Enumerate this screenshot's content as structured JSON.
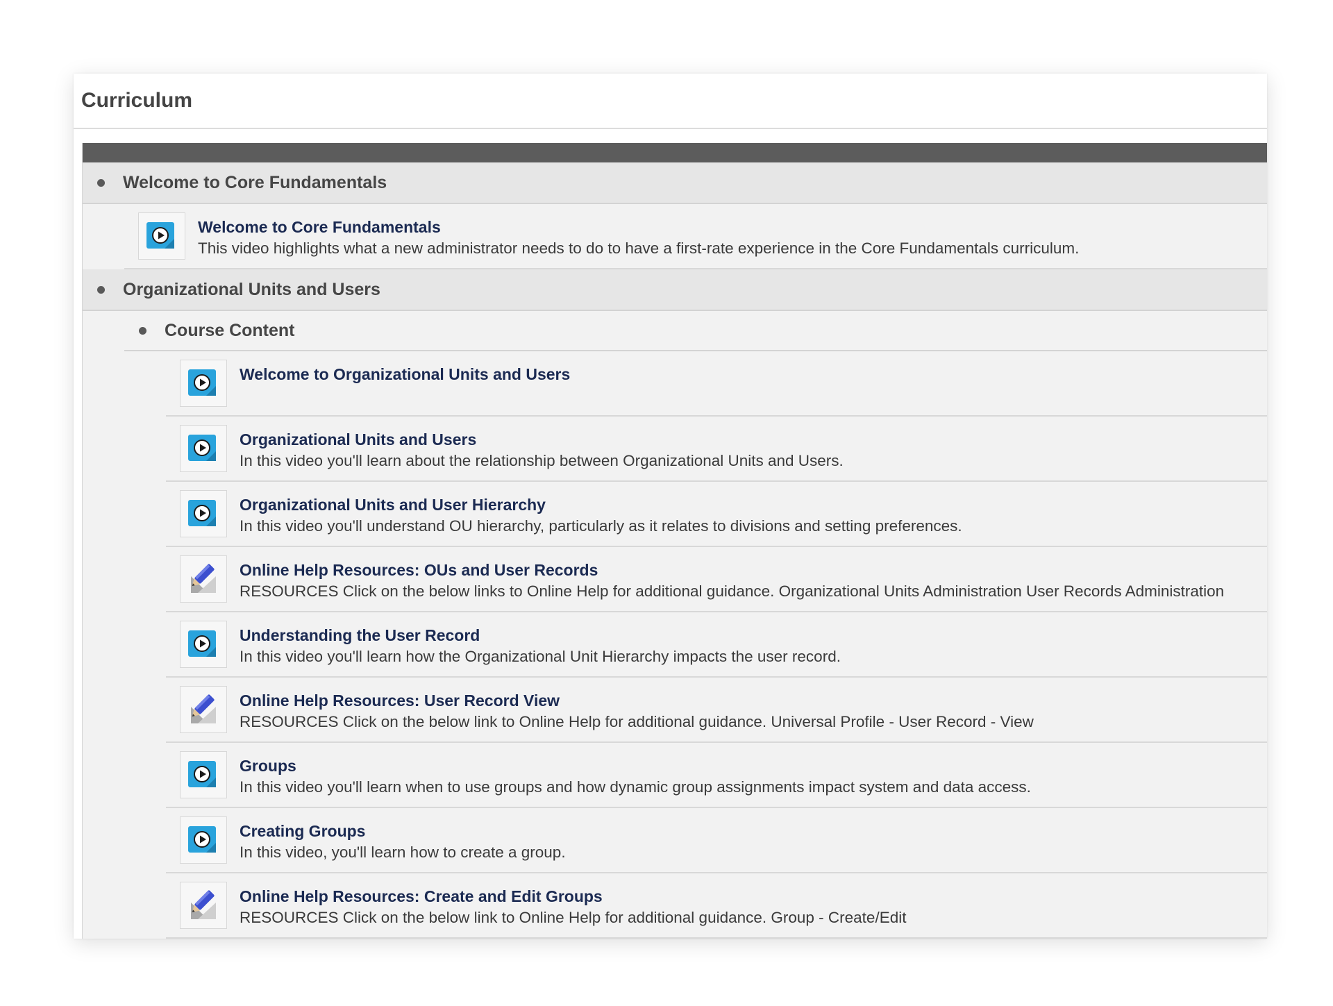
{
  "panel": {
    "title": "Curriculum"
  },
  "colors": {
    "header_bar": "#5c5c5c",
    "link": "#1b2a52",
    "video_icon": "#29a3dc"
  },
  "sections": [
    {
      "title": "Welcome to Core Fundamentals",
      "items": [
        {
          "icon": "video-icon",
          "title": "Welcome to Core Fundamentals",
          "description": "This video highlights what a new administrator needs to do to have a first-rate experience in the Core Fundamentals curriculum."
        }
      ]
    },
    {
      "title": "Organizational Units and Users",
      "subsection": {
        "title": "Course Content",
        "items": [
          {
            "icon": "video-icon",
            "title": "Welcome to Organizational Units and Users",
            "description": ""
          },
          {
            "icon": "video-icon",
            "title": "Organizational Units and Users",
            "description": "In this video you'll learn about the relationship between Organizational Units and Users."
          },
          {
            "icon": "video-icon",
            "title": "Organizational Units and User Hierarchy",
            "description": "In this video you'll understand OU hierarchy, particularly as it relates to divisions and setting preferences."
          },
          {
            "icon": "material-pencil-icon",
            "title": "Online Help Resources: OUs and User Records",
            "description": "RESOURCES Click on the below links to Online Help for additional guidance. Organizational Units Administration User Records Administration"
          },
          {
            "icon": "video-icon",
            "title": "Understanding the User Record",
            "description": "In this video you'll learn how the Organizational Unit Hierarchy impacts the user record."
          },
          {
            "icon": "material-pencil-icon",
            "title": "Online Help Resources: User Record View",
            "description": "RESOURCES Click on the below link to Online Help for additional guidance. Universal Profile - User Record - View"
          },
          {
            "icon": "video-icon",
            "title": "Groups",
            "description": "In this video you'll learn when to use groups and how dynamic group assignments impact system and data access."
          },
          {
            "icon": "video-icon",
            "title": "Creating Groups",
            "description": "In this video, you'll learn how to create a group."
          },
          {
            "icon": "material-pencil-icon",
            "title": "Online Help Resources: Create and Edit Groups",
            "description": "RESOURCES Click on the below link to Online Help for additional guidance. Group - Create/Edit"
          }
        ]
      }
    }
  ]
}
